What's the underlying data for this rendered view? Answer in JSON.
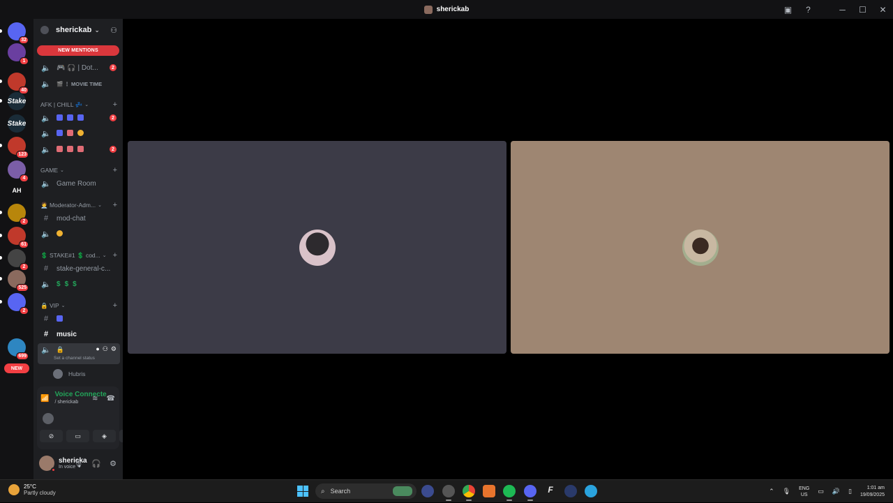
{
  "window": {
    "title": "sherickab"
  },
  "rail": {
    "servers": [
      {
        "name": "direct-messages",
        "badge": "32",
        "color": "#5865f2",
        "label": ""
      },
      {
        "name": "server-1",
        "badge": "1",
        "color": "#6a3fa0",
        "label": ""
      },
      {
        "name": "server-2",
        "badge": "40",
        "color": "#c0392b",
        "label": ""
      },
      {
        "name": "server-stake-1",
        "badge": "",
        "color": "#1a2c38",
        "label": "Stake"
      },
      {
        "name": "server-stake-2",
        "badge": "",
        "color": "#1a2c38",
        "label": "Stake"
      },
      {
        "name": "server-3",
        "badge": "123",
        "color": "#c0392b",
        "label": ""
      },
      {
        "name": "server-4",
        "badge": "4",
        "color": "#7b5ea7",
        "label": ""
      },
      {
        "name": "server-ah",
        "badge": "",
        "color": "#121214",
        "label": "AH"
      },
      {
        "name": "server-5",
        "badge": "2",
        "color": "#b8860b",
        "label": ""
      },
      {
        "name": "server-6",
        "badge": "61",
        "color": "#c0392b",
        "label": ""
      },
      {
        "name": "server-7",
        "badge": "2",
        "color": "#444",
        "label": ""
      },
      {
        "name": "server-8",
        "badge": "525",
        "color": "#8a6a5e",
        "label": ""
      },
      {
        "name": "server-9",
        "badge": "2",
        "color": "#5865f2",
        "label": ""
      },
      {
        "name": "folder",
        "badge": "",
        "color": "#121214",
        "label": ""
      },
      {
        "name": "server-10",
        "badge": "699",
        "color": "#2e86c1",
        "label": ""
      }
    ],
    "new_label": "NEW"
  },
  "sidebar": {
    "server_name": "sherickab",
    "new_mentions": "NEW MENTIONS",
    "channels_top": [
      {
        "label": "🎮 🎧 | Dot...",
        "count": "2"
      },
      {
        "label": "🎬 ⋮ MOVIE TIME",
        "count": ""
      }
    ],
    "cat_afk": "AFK | CHILL 💤",
    "afk_channels": [
      {
        "count": "2"
      },
      {
        "count": ""
      },
      {
        "count": "2"
      }
    ],
    "cat_game": "GAME",
    "game_room": "Game Room",
    "cat_mod": "🧑‍💼 Moderator-Adm...",
    "mod_chat": "mod-chat",
    "cat_stake": "💲 STAKE#1 💲 cod...",
    "stake_general": "stake-general-c...",
    "cat_vip": "🔒 VIP",
    "music": "music",
    "voice_status": "Set a channel status",
    "member": "Hubris"
  },
  "voice_panel": {
    "title": "Voice Connecte",
    "sub": "/ sherickab"
  },
  "user_panel": {
    "name": "shericka",
    "status": "In voice"
  },
  "taskbar": {
    "temp": "25°C",
    "condition": "Partly cloudy",
    "search": "Search",
    "lang_1": "ENG",
    "lang_2": "US",
    "time": "1:01 am",
    "date": "19/09/2025"
  },
  "colors": {
    "accent_red": "#f23f43",
    "voice_green": "#23a55a",
    "tile_1": "#3c3b47",
    "tile_2": "#9e8672"
  }
}
